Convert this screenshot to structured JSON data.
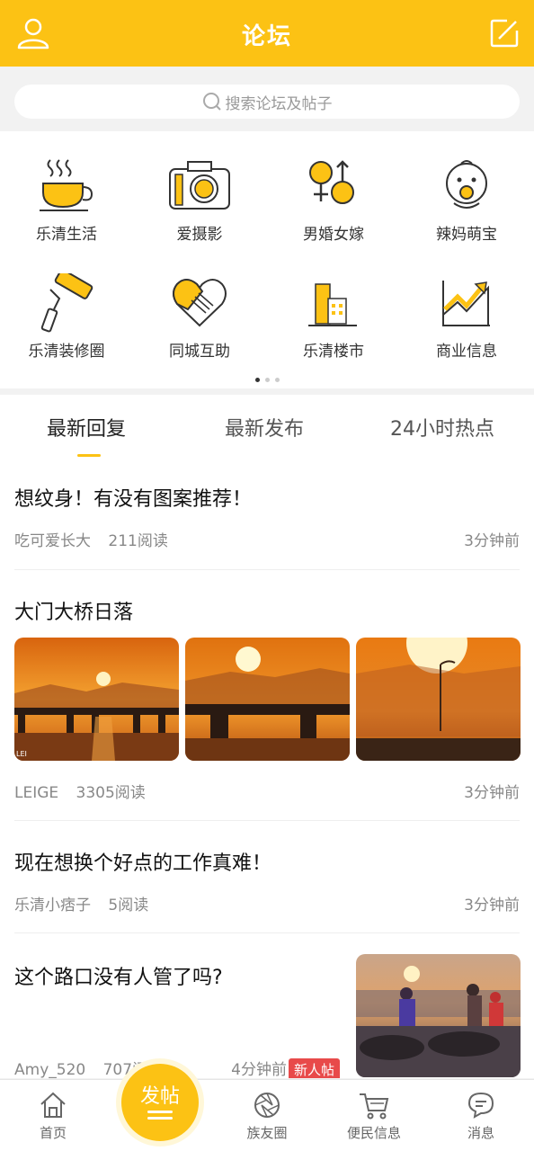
{
  "header": {
    "title": "论坛"
  },
  "search": {
    "placeholder": "搜索论坛及帖子"
  },
  "categories": [
    {
      "label": "乐清生活",
      "icon": "coffee-cup-icon"
    },
    {
      "label": "爱摄影",
      "icon": "camera-icon"
    },
    {
      "label": "男婚女嫁",
      "icon": "gender-icon"
    },
    {
      "label": "辣妈萌宝",
      "icon": "baby-icon"
    },
    {
      "label": "乐清装修圈",
      "icon": "paint-roller-icon"
    },
    {
      "label": "同城互助",
      "icon": "heart-hands-icon"
    },
    {
      "label": "乐清楼市",
      "icon": "building-icon"
    },
    {
      "label": "商业信息",
      "icon": "trend-chart-icon"
    }
  ],
  "tabs": [
    {
      "label": "最新回复",
      "active": true
    },
    {
      "label": "最新发布",
      "active": false
    },
    {
      "label": "24小时热点",
      "active": false
    }
  ],
  "posts": [
    {
      "title": "想纹身！有没有图案推荐！",
      "author": "吃可爱长大",
      "reads": "211阅读",
      "time": "3分钟前"
    },
    {
      "title": "大门大桥日落",
      "author": "LEIGE",
      "reads": "3305阅读",
      "time": "3分钟前",
      "photo_watermark": "LEI"
    },
    {
      "title": "现在想换个好点的工作真难！",
      "author": "乐清小痞子",
      "reads": "5阅读",
      "time": "3分钟前"
    },
    {
      "title": "这个路口没有人管了吗?",
      "author": "Amy_520",
      "reads": "707阅",
      "time": "4分钟前",
      "badge": "新人帖"
    }
  ],
  "tabbar": {
    "home": "首页",
    "post": "发帖",
    "friends": "族友圈",
    "info": "便民信息",
    "messages": "消息"
  },
  "colors": {
    "accent": "#fcc214",
    "badge": "#e84a4a"
  }
}
